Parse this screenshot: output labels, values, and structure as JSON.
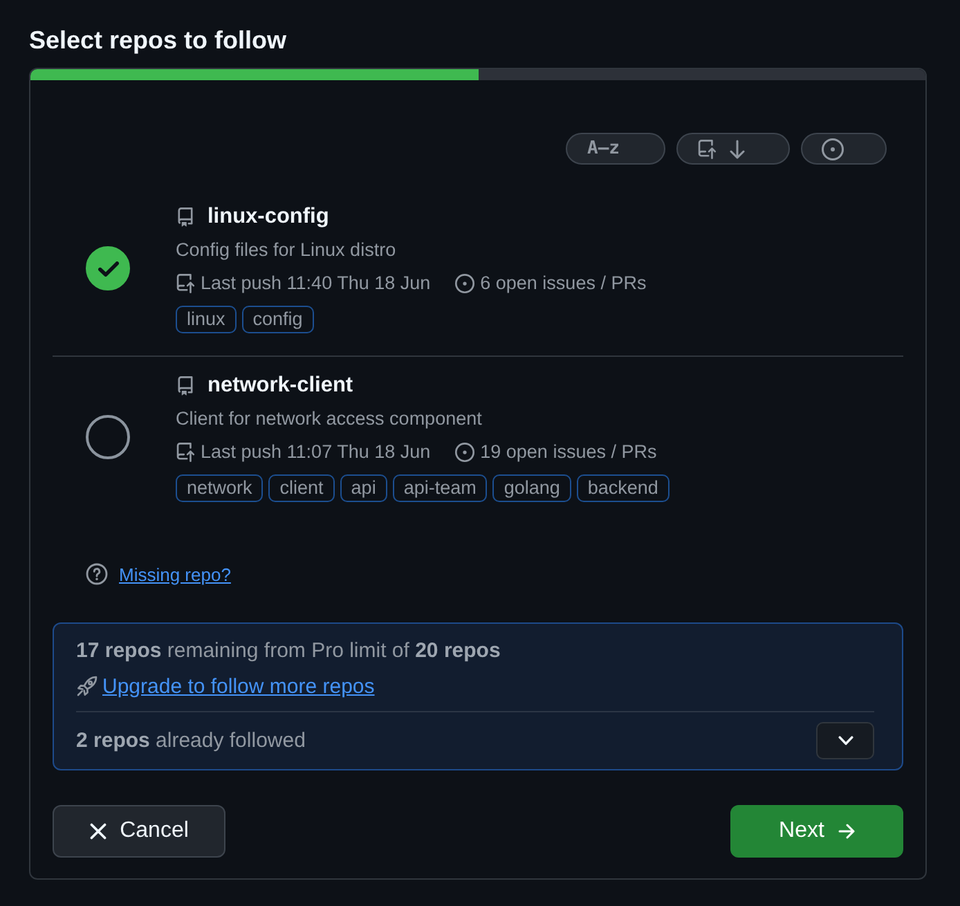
{
  "title": "Select repos to follow",
  "progress": {
    "level": 0.5
  },
  "sort_options": [
    {
      "kind": "name",
      "label": "A–z"
    },
    {
      "kind": "push"
    },
    {
      "kind": "issues"
    }
  ],
  "repos": [
    {
      "name": "linux-config",
      "description": "Config files for Linux distro",
      "last_push": "Last push 11:40 Thu 18 Jun",
      "issues": "6 open issues / PRs",
      "topics": [
        "linux",
        "config"
      ],
      "selected": true
    },
    {
      "name": "network-client",
      "description": "Client for network access component",
      "last_push": "Last push 11:07 Thu 18 Jun",
      "issues": "19 open issues / PRs",
      "topics": [
        "network",
        "client",
        "api",
        "api-team",
        "golang",
        "backend"
      ],
      "selected": false
    }
  ],
  "missing_repo_link": "Missing repo?",
  "limit_panel": {
    "remaining": "**17 repos** remaining from Pro limit of **20 repos**",
    "upgrade_link": "Upgrade to follow more repos",
    "followed": "**2 repos** already followed",
    "expanded": false
  },
  "buttons": [
    {
      "kind": "cancel",
      "label": "Cancel"
    },
    {
      "kind": "next",
      "label": "Next"
    }
  ]
}
